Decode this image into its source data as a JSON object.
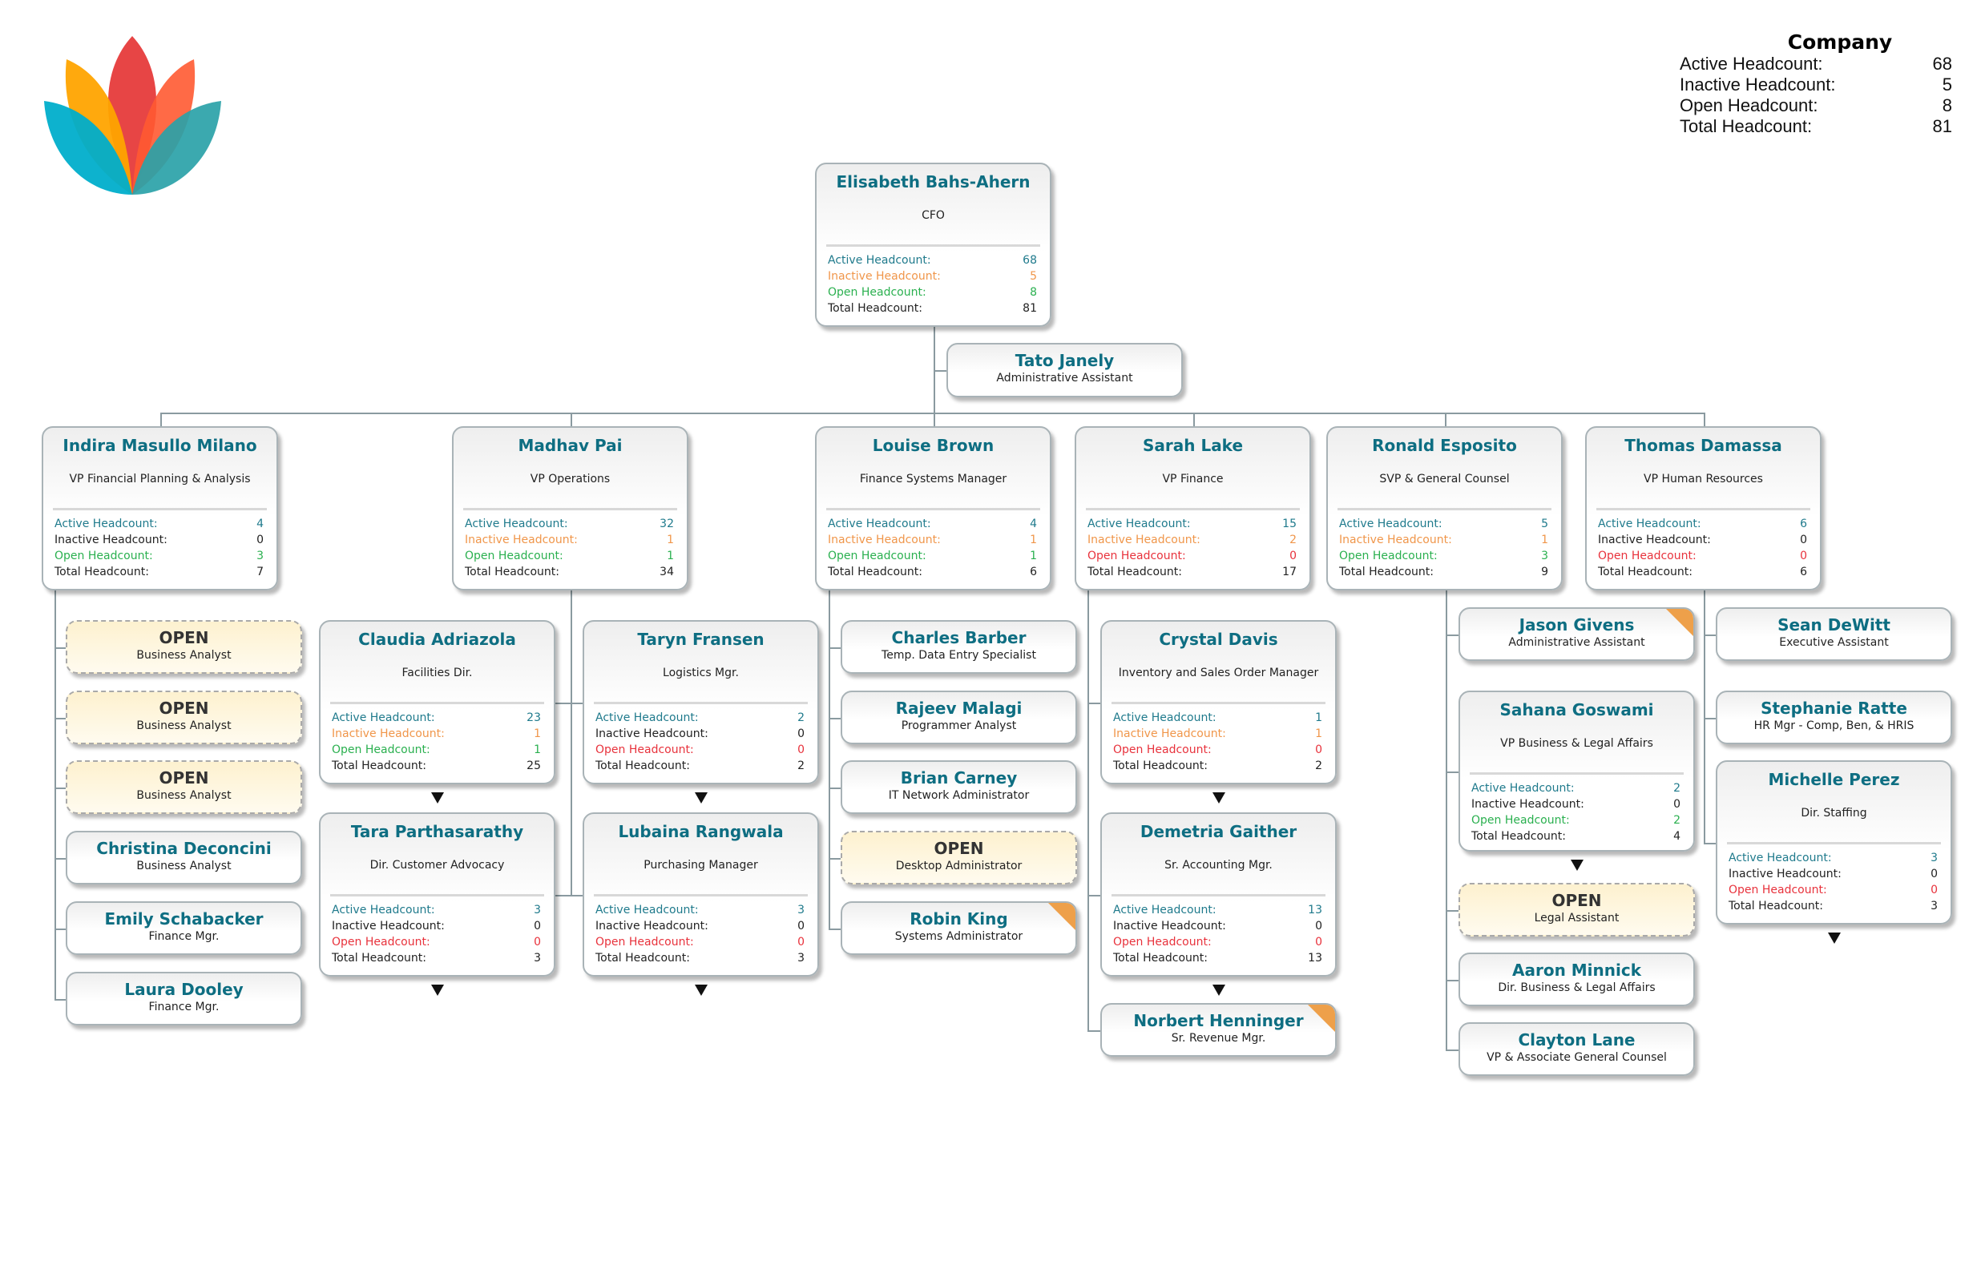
{
  "company_summary": {
    "title": "Company",
    "rows": [
      {
        "label": "Active Headcount:",
        "value": "68"
      },
      {
        "label": "Inactive Headcount:",
        "value": "5"
      },
      {
        "label": "Open Headcount:",
        "value": "8"
      },
      {
        "label": "Total Headcount:",
        "value": "81"
      }
    ]
  },
  "logo": {
    "icon": "lotus-logo-icon"
  },
  "stat_labels": {
    "active": "Active Headcount:",
    "inactive": "Inactive Headcount:",
    "open": "Open Headcount:",
    "total": "Total Headcount:"
  },
  "colors": {
    "name": "#0e6e82",
    "active": "#1f7a8c",
    "inactive_nonzero": "#f0964a",
    "open_nonzero": "#2ab04f",
    "zero_alert": "#e8323c",
    "neutral": "#222222",
    "open_position_bg": "#fdf1cf",
    "flag": "#eea04a"
  },
  "nodes": [
    {
      "id": "cfo",
      "name": "Elisabeth Bahs-Ahern",
      "title": "CFO",
      "stats": {
        "active": 68,
        "inactive": 5,
        "open": 8,
        "total": 81
      }
    },
    {
      "id": "tato",
      "name": "Tato Janely",
      "title": "Administrative Assistant",
      "parent": "cfo",
      "assistant": true
    },
    {
      "id": "indira",
      "name": "Indira Masullo Milano",
      "title": "VP Financial Planning & Analysis",
      "parent": "cfo",
      "stats": {
        "active": 4,
        "inactive": 0,
        "open": 3,
        "total": 7
      }
    },
    {
      "id": "madhav",
      "name": "Madhav Pai",
      "title": "VP Operations",
      "parent": "cfo",
      "stats": {
        "active": 32,
        "inactive": 1,
        "open": 1,
        "total": 34
      }
    },
    {
      "id": "louise",
      "name": "Louise Brown",
      "title": "Finance Systems Manager",
      "parent": "cfo",
      "stats": {
        "active": 4,
        "inactive": 1,
        "open": 1,
        "total": 6
      }
    },
    {
      "id": "sarah",
      "name": "Sarah Lake",
      "title": "VP Finance",
      "parent": "cfo",
      "stats": {
        "active": 15,
        "inactive": 2,
        "open": 0,
        "total": 17
      }
    },
    {
      "id": "ronald",
      "name": "Ronald Esposito",
      "title": "SVP & General Counsel",
      "parent": "cfo",
      "stats": {
        "active": 5,
        "inactive": 1,
        "open": 3,
        "total": 9
      }
    },
    {
      "id": "thomas",
      "name": "Thomas Damassa",
      "title": "VP Human Resources",
      "parent": "cfo",
      "stats": {
        "active": 6,
        "inactive": 0,
        "open": 0,
        "total": 6
      }
    },
    {
      "id": "open1",
      "name": "OPEN",
      "title": "Business Analyst",
      "parent": "indira",
      "open_position": true
    },
    {
      "id": "open2",
      "name": "OPEN",
      "title": "Business Analyst",
      "parent": "indira",
      "open_position": true
    },
    {
      "id": "open3",
      "name": "OPEN",
      "title": "Business Analyst",
      "parent": "indira",
      "open_position": true
    },
    {
      "id": "christina",
      "name": "Christina Deconcini",
      "title": "Business Analyst",
      "parent": "indira"
    },
    {
      "id": "emily",
      "name": "Emily Schabacker",
      "title": "Finance Mgr.",
      "parent": "indira"
    },
    {
      "id": "laura",
      "name": "Laura Dooley",
      "title": "Finance Mgr.",
      "parent": "indira"
    },
    {
      "id": "claudia",
      "name": "Claudia Adriazola",
      "title": "Facilities Dir.",
      "parent": "madhav",
      "stats": {
        "active": 23,
        "inactive": 1,
        "open": 1,
        "total": 25
      },
      "collapsed": true
    },
    {
      "id": "tara",
      "name": "Tara Parthasarathy",
      "title": "Dir. Customer Advocacy",
      "parent": "madhav",
      "stats": {
        "active": 3,
        "inactive": 0,
        "open": 0,
        "total": 3
      },
      "collapsed": true
    },
    {
      "id": "taryn",
      "name": "Taryn Fransen",
      "title": "Logistics Mgr.",
      "parent": "madhav",
      "stats": {
        "active": 2,
        "inactive": 0,
        "open": 0,
        "total": 2
      },
      "collapsed": true
    },
    {
      "id": "lubaina",
      "name": "Lubaina Rangwala",
      "title": "Purchasing Manager",
      "parent": "madhav",
      "stats": {
        "active": 3,
        "inactive": 0,
        "open": 0,
        "total": 3
      },
      "collapsed": true
    },
    {
      "id": "charles",
      "name": "Charles Barber",
      "title": "Temp. Data Entry Specialist",
      "parent": "louise"
    },
    {
      "id": "rajeev",
      "name": "Rajeev Malagi",
      "title": "Programmer Analyst",
      "parent": "louise"
    },
    {
      "id": "brian",
      "name": "Brian Carney",
      "title": "IT Network Administrator",
      "parent": "louise"
    },
    {
      "id": "open4",
      "name": "OPEN",
      "title": "Desktop Administrator",
      "parent": "louise",
      "open_position": true
    },
    {
      "id": "robin",
      "name": "Robin King",
      "title": "Systems Administrator",
      "parent": "louise",
      "flagged": true
    },
    {
      "id": "crystal",
      "name": "Crystal Davis",
      "title": "Inventory and Sales Order Manager",
      "parent": "sarah",
      "stats": {
        "active": 1,
        "inactive": 1,
        "open": 0,
        "total": 2
      },
      "collapsed": true
    },
    {
      "id": "demetria",
      "name": "Demetria Gaither",
      "title": "Sr. Accounting Mgr.",
      "parent": "sarah",
      "stats": {
        "active": 13,
        "inactive": 0,
        "open": 0,
        "total": 13
      },
      "collapsed": true
    },
    {
      "id": "norbert",
      "name": "Norbert Henninger",
      "title": "Sr. Revenue Mgr.",
      "parent": "sarah",
      "flagged": true
    },
    {
      "id": "jason",
      "name": "Jason Givens",
      "title": "Administrative Assistant",
      "parent": "ronald",
      "flagged": true
    },
    {
      "id": "sahana",
      "name": "Sahana Goswami",
      "title": "VP Business & Legal Affairs",
      "parent": "ronald",
      "stats": {
        "active": 2,
        "inactive": 0,
        "open": 2,
        "total": 4
      },
      "collapsed": true
    },
    {
      "id": "open5",
      "name": "OPEN",
      "title": "Legal Assistant",
      "parent": "ronald",
      "open_position": true
    },
    {
      "id": "aaron",
      "name": "Aaron Minnick",
      "title": "Dir. Business & Legal Affairs",
      "parent": "ronald"
    },
    {
      "id": "clayton",
      "name": "Clayton Lane",
      "title": "VP & Associate General Counsel",
      "parent": "ronald"
    },
    {
      "id": "sean",
      "name": "Sean DeWitt",
      "title": "Executive Assistant",
      "parent": "thomas"
    },
    {
      "id": "stephanie",
      "name": "Stephanie Ratte",
      "title": "HR Mgr - Comp, Ben, & HRIS",
      "parent": "thomas"
    },
    {
      "id": "michelle",
      "name": "Michelle Perez",
      "title": "Dir. Staffing",
      "parent": "thomas",
      "stats": {
        "active": 3,
        "inactive": 0,
        "open": 0,
        "total": 3
      },
      "collapsed": true
    }
  ]
}
